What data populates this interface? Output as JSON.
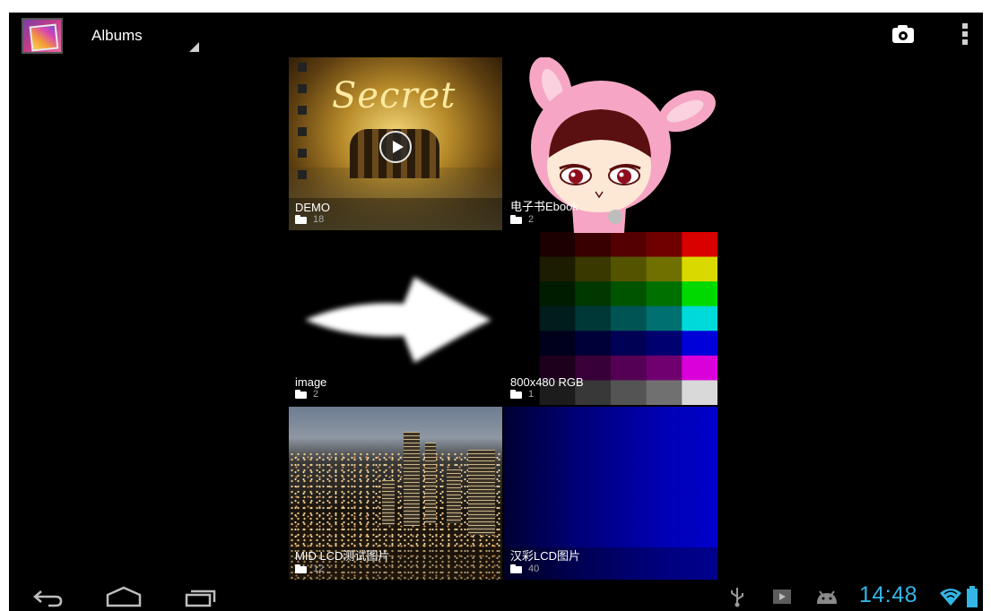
{
  "action_bar": {
    "title": "Albums",
    "camera_icon": "camera-icon",
    "overflow_icon": "overflow-menu-icon"
  },
  "albums": [
    {
      "name": "DEMO",
      "count": "18",
      "type": "video"
    },
    {
      "name": "电子书Ebook",
      "count": "2",
      "type": "image"
    },
    {
      "name": "image",
      "count": "2",
      "type": "image"
    },
    {
      "name": "800x480 RGB",
      "count": "1",
      "type": "image"
    },
    {
      "name": "MID LCD测试图片",
      "count": "12",
      "type": "image"
    },
    {
      "name": "汉彩LCD图片",
      "count": "40",
      "type": "image"
    }
  ],
  "thumbnail_texts": {
    "demo_brand": "Secret"
  },
  "nav_bar": {
    "back_icon": "back-icon",
    "home_icon": "home-icon",
    "recents_icon": "recent-apps-icon"
  },
  "status_bar": {
    "time": "14:48",
    "icons": [
      "usb-icon",
      "media-play-icon",
      "android-debug-icon",
      "wifi-icon",
      "battery-icon"
    ]
  },
  "colors": {
    "background": "#000000",
    "accent_time": "#33b5e5"
  }
}
